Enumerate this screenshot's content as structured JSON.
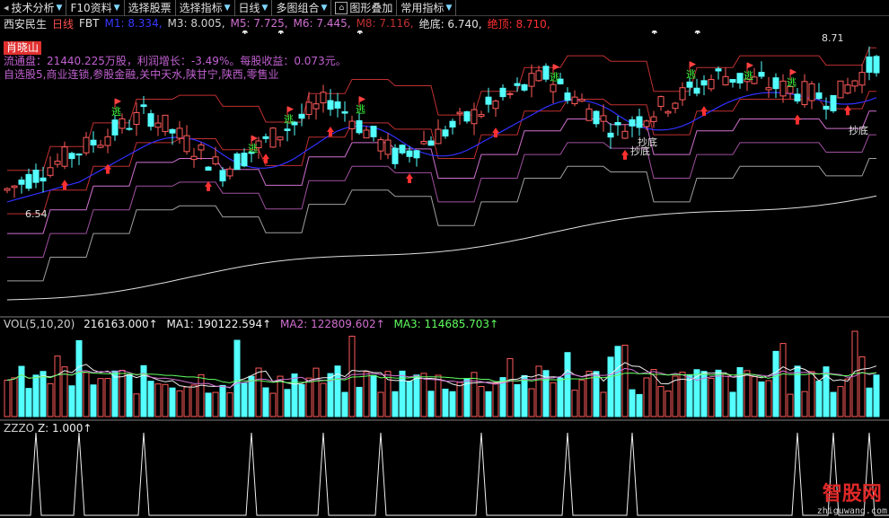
{
  "toolbar": {
    "items": [
      {
        "label": "技术分析",
        "lead": "◂",
        "caret": true
      },
      {
        "label": "F10资料",
        "caret": true
      },
      {
        "label": "选择股票",
        "caret": false
      },
      {
        "label": "选择指标",
        "caret": true
      },
      {
        "label": "日线",
        "caret": true
      },
      {
        "label": "多图组合",
        "caret": true
      },
      {
        "label": "图形叠加",
        "caret": false
      },
      {
        "label": "常用指标",
        "caret": true
      }
    ]
  },
  "info_bar": {
    "stock_name": "西安民生",
    "period": "日线",
    "indicator": "FBT",
    "m1": "M1: 8.334,",
    "m3": "M3: 8.005,",
    "m5": "M5: 7.725,",
    "m6": "M6: 7.445,",
    "m8": "M8: 7.116,",
    "bottom": "绝底: 6.740,",
    "top": "绝顶: 8.710,"
  },
  "side_info": {
    "badge": "肖晓山",
    "line1": "流通盘：21440.225万股，利润增长：-3.49%。每股收益：0.073元。",
    "line2": "自选股5,商业连锁,参股金融,关中天水,陕甘宁,陕西,零售业"
  },
  "chart_labels": {
    "high_price": "8.71",
    "low_price": "6.54",
    "chaodi": "抄底",
    "tao": "逃"
  },
  "volume": {
    "title": "VOL(5,10,20)",
    "vol": "216163.000↑",
    "ma1": "MA1: 190122.594↑",
    "ma2": "MA2: 122809.602↑",
    "ma3": "MA3: 114685.703↑"
  },
  "zzzo": {
    "title": "ZZZO",
    "z": "Z: 1.000↑"
  },
  "logo": {
    "name": "智股网",
    "url_text": "zhiguwang.com"
  },
  "colors": {
    "up": "#ff5a5a",
    "down": "#54ffff",
    "m_line": "#3030ff",
    "purple": "#d070d0",
    "bands_red": "#c03030"
  }
}
